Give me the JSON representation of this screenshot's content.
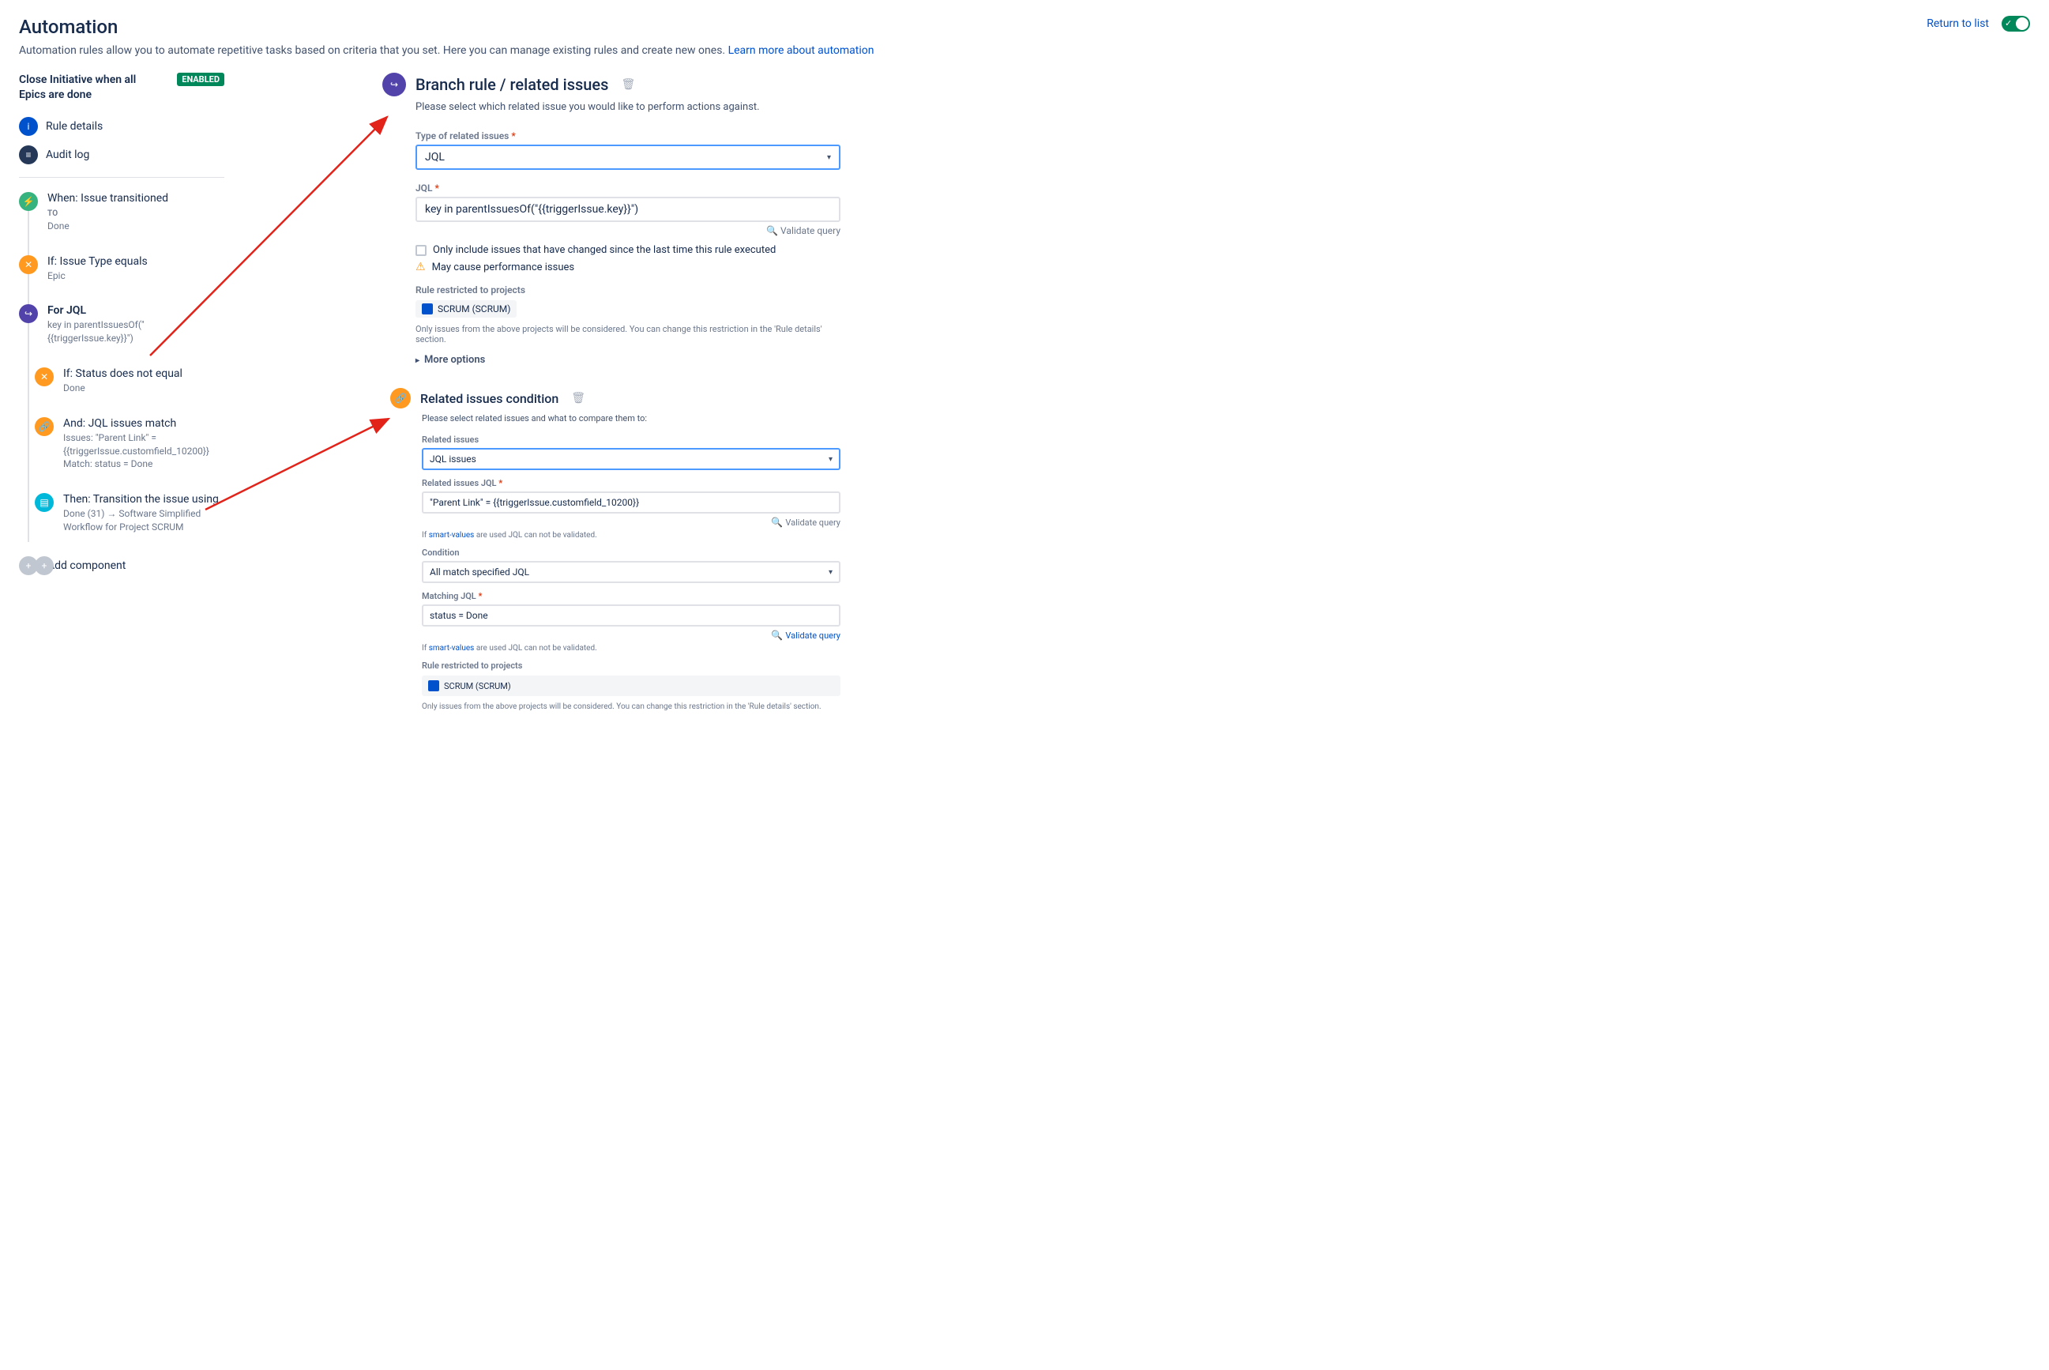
{
  "header": {
    "title": "Automation",
    "subtitle_before": "Automation rules allow you to automate repetitive tasks based on criteria that you set. Here you can manage existing rules and create new ones. ",
    "subtitle_link": "Learn more about automation",
    "return_link": "Return to list"
  },
  "sidebar": {
    "rule_name": "Close Initiative when all Epics are done",
    "status_pill": "ENABLED",
    "nav": {
      "details": "Rule details",
      "audit": "Audit log"
    },
    "steps": {
      "when_title": "When: Issue transitioned",
      "when_to": "TO",
      "when_done": "Done",
      "if_type_title": "If: Issue Type equals",
      "if_type_sub": "Epic",
      "for_jql_title": "For JQL",
      "for_jql_sub1": "key in parentIssuesOf(\"",
      "for_jql_sub2": "{{triggerIssue.key}}\")",
      "if_status_title": "If: Status does not equal",
      "if_status_sub": "Done",
      "and_jql_title": "And: JQL issues match",
      "and_jql_sub1": "Issues: \"Parent Link\" =",
      "and_jql_sub2": "{{triggerIssue.customfield_10200}}",
      "and_jql_sub3": "Match: status = Done",
      "then_title": "Then: Transition the issue using",
      "then_sub": "Done (31) → Software Simplified Workflow for Project SCRUM"
    },
    "add_component": "Add component"
  },
  "panel1": {
    "title": "Branch rule / related issues",
    "desc": "Please select which related issue you would like to perform actions against.",
    "type_label": "Type of related issues",
    "type_value": "JQL",
    "jql_label": "JQL",
    "jql_value": "key in parentIssuesOf(\"{{triggerIssue.key}}\")",
    "validate": "Validate query",
    "only_changed": "Only include issues that have changed since the last time this rule executed",
    "warn": "May cause performance issues",
    "restricted_label": "Rule restricted to projects",
    "project_chip": "SCRUM (SCRUM)",
    "restricted_hint": "Only issues from the above projects will be considered. You can change this restriction in the 'Rule details' section.",
    "more_options": "More options"
  },
  "panel2": {
    "title": "Related issues condition",
    "desc": "Please select related issues and what to compare them to:",
    "rel_label": "Related issues",
    "rel_value": "JQL issues",
    "rel_jql_label": "Related issues JQL",
    "rel_jql_value": "\"Parent Link\" = {{triggerIssue.customfield_10200}}",
    "sv_note_before": "If ",
    "sv_link": "smart-values",
    "sv_note_after": " are used JQL can not be validated.",
    "cond_label": "Condition",
    "cond_value": "All match specified JQL",
    "match_label": "Matching JQL",
    "match_value": "status = Done",
    "validate": "Validate query",
    "restricted_label": "Rule restricted to projects",
    "project_chip": "SCRUM (SCRUM)",
    "restricted_hint": "Only issues from the above projects will be considered. You can change this restriction in the 'Rule details' section."
  }
}
